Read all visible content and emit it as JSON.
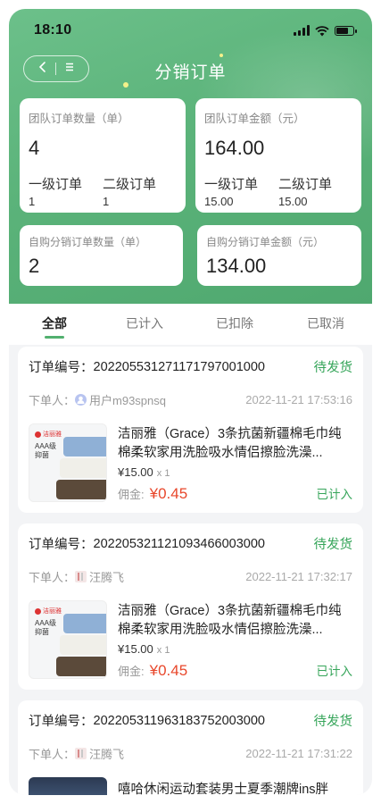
{
  "status_bar": {
    "time": "18:10"
  },
  "nav": {
    "title": "分销订单"
  },
  "stats": {
    "team_count": {
      "label": "团队订单数量（单）",
      "value": "4",
      "level1_label": "一级订单",
      "level1_value": "1",
      "level2_label": "二级订单",
      "level2_value": "1"
    },
    "team_amount": {
      "label": "团队订单金额（元）",
      "value": "164.00",
      "level1_label": "一级订单",
      "level1_value": "15.00",
      "level2_label": "二级订单",
      "level2_value": "15.00"
    },
    "self_count": {
      "label": "自购分销订单数量（单）",
      "value": "2"
    },
    "self_amount": {
      "label": "自购分销订单金额（元）",
      "value": "134.00"
    }
  },
  "tabs": [
    {
      "label": "全部",
      "active": true
    },
    {
      "label": "已计入",
      "active": false
    },
    {
      "label": "已扣除",
      "active": false
    },
    {
      "label": "已取消",
      "active": false
    }
  ],
  "orders": [
    {
      "order_label": "订单编号：",
      "order_no": "2022055312711717970010​00",
      "status": "待发货",
      "buyer_label": "下单人：",
      "buyer": "用户m93spnsq",
      "time": "2022-11-21 17:53:16",
      "product_title": "洁丽雅（Grace）3条抗菌新疆棉毛巾纯棉柔软家用洗脸吸水情侣擦脸洗澡...",
      "price": "¥15.00",
      "qty": "x 1",
      "commission_label": "佣金:",
      "commission": "¥0.45",
      "commission_status": "已计入"
    },
    {
      "order_label": "订单编号：",
      "order_no": "202205321121093466003000",
      "status": "待发货",
      "buyer_label": "下单人：",
      "buyer": "汪腾飞",
      "time": "2022-11-21 17:32:17",
      "product_title": "洁丽雅（Grace）3条抗菌新疆棉毛巾纯棉柔软家用洗脸吸水情侣擦脸洗澡...",
      "price": "¥15.00",
      "qty": "x 1",
      "commission_label": "佣金:",
      "commission": "¥0.45",
      "commission_status": "已计入"
    },
    {
      "order_label": "订单编号：",
      "order_no": "202205311963183752003000",
      "status": "待发货",
      "buyer_label": "下单人：",
      "buyer": "汪腾飞",
      "time": "2022-11-21 17:31:22",
      "product_title": "嘻哈休闲运动套装男士夏季潮牌ins胖"
    }
  ],
  "product_image": {
    "brand": "洁丽雅",
    "grade": "AAA级",
    "feature": "抑菌"
  },
  "colors": {
    "brand_green": "#52b06f",
    "status_green": "#36a55a",
    "commission_red": "#e8472b"
  }
}
